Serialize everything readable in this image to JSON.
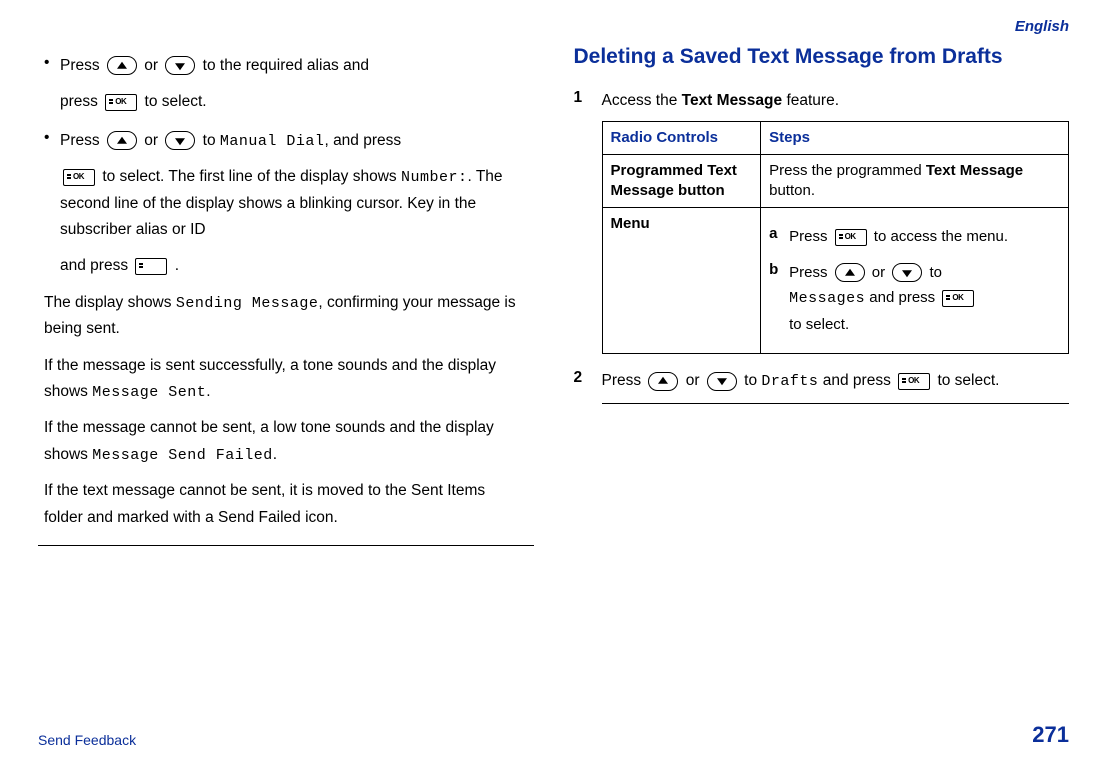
{
  "header": {
    "language": "English"
  },
  "left": {
    "bullet1": {
      "press1": "Press",
      "or": "or",
      "tail1": "to the required alias and",
      "press2": "press",
      "tail2": "to select."
    },
    "bullet2": {
      "press1": "Press",
      "or": "or",
      "to": "to",
      "manual_dial": "Manual Dial",
      "and_press": ", and press",
      "tail1": "to select. The first line of the display shows",
      "number": "Number:",
      "line2": ". The second line of the display shows a blinking cursor. Key in the subscriber alias or ID",
      "and_press2": "and press",
      "period": "."
    },
    "para1_a": "The display shows ",
    "para1_mono": "Sending Message",
    "para1_b": ", confirming your message is being sent.",
    "para2_a": "If the message is sent successfully, a tone sounds and the display shows ",
    "para2_mono": "Message Sent",
    "para2_b": ".",
    "para3_a": "If the message cannot be sent, a low tone sounds and the display shows ",
    "para3_mono": "Message Send Failed",
    "para3_b": ".",
    "para4": "If the text message cannot be sent, it is moved to the Sent Items folder and marked with a Send Failed icon."
  },
  "right": {
    "title": "Deleting a Saved Text Message from Drafts",
    "step1": {
      "num": "1",
      "intro_a": "Access the ",
      "intro_bold": "Text Message",
      "intro_b": " feature."
    },
    "table": {
      "h1": "Radio Con­trols",
      "h2": "Steps",
      "row1_col1": "Programmed Text Mes­sage button",
      "row1_col2_a": "Press the programmed ",
      "row1_col2_bold": "Text Message",
      "row1_col2_b": " button.",
      "row2_col1": "Menu",
      "sub_a": {
        "letter": "a",
        "t1": "Press",
        "t2": "to access the menu."
      },
      "sub_b": {
        "letter": "b",
        "t1": "Press",
        "or": "or",
        "to": "to",
        "messages": "Messages",
        "and_press": " and press",
        "tail": "to select."
      }
    },
    "step2": {
      "num": "2",
      "t1": "Press",
      "or": "or",
      "to": "to",
      "drafts": "Drafts",
      "and_press": " and press",
      "tail": "to select."
    }
  },
  "footer": {
    "send_feedback": "Send Feedback",
    "page_number": "271"
  }
}
